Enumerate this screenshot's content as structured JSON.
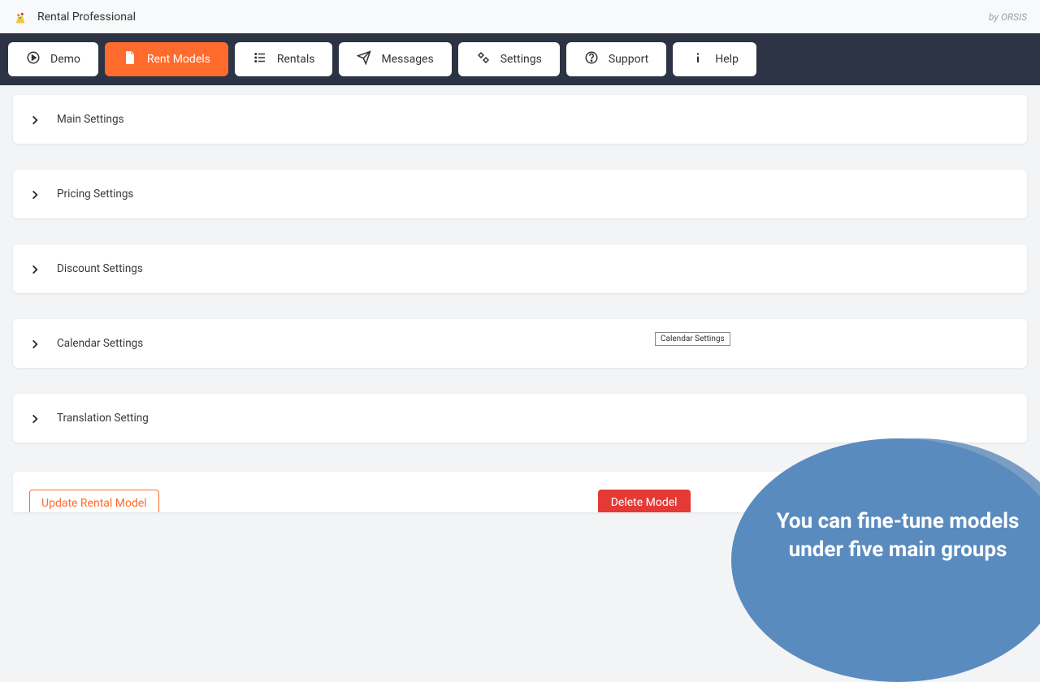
{
  "app": {
    "title": "Rental Professional",
    "vendor": "by ORSIS"
  },
  "nav": {
    "demo": "Demo",
    "rent_models": "Rent Models",
    "rentals": "Rentals",
    "messages": "Messages",
    "settings": "Settings",
    "support": "Support",
    "help": "Help"
  },
  "accordions": {
    "main_settings": "Main Settings",
    "pricing_settings": "Pricing Settings",
    "discount_settings": "Discount Settings",
    "calendar_settings": "Calendar Settings",
    "translation_setting": "Translation Setting"
  },
  "tooltip": {
    "calendar": "Calendar Settings"
  },
  "actions": {
    "update": "Update Rental Model",
    "delete": "Delete Model"
  },
  "callout": {
    "text": "You can fine-tune models under five main groups"
  },
  "colors": {
    "navbar": "#2c3344",
    "accent": "#ff6b2c",
    "danger": "#e53935",
    "callout": "#5a8bbf"
  }
}
